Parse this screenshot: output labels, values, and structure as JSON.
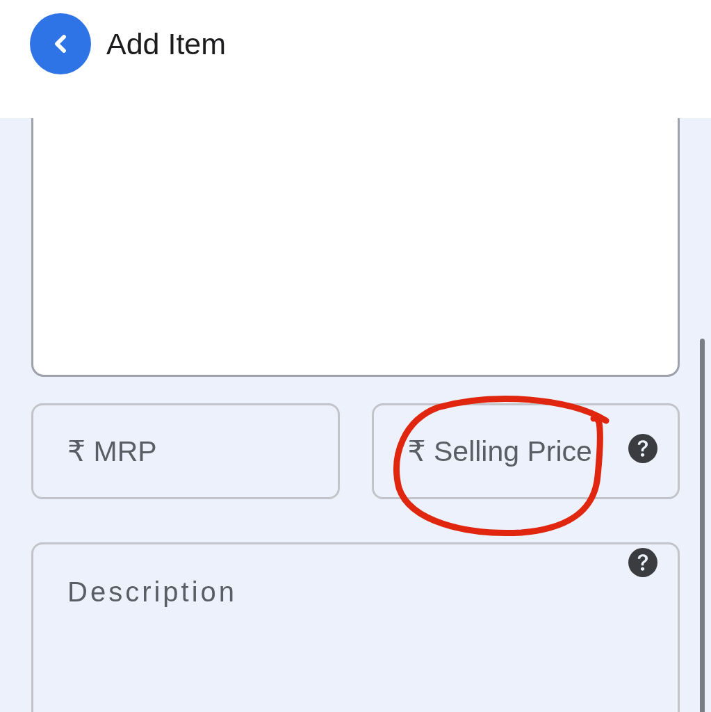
{
  "header": {
    "title": "Add Item"
  },
  "price_fields": [
    {
      "placeholder": "₹ MRP",
      "help": false
    },
    {
      "placeholder": "₹ Selling Price",
      "help": true
    }
  ],
  "description": {
    "placeholder": "Description",
    "help": true
  }
}
